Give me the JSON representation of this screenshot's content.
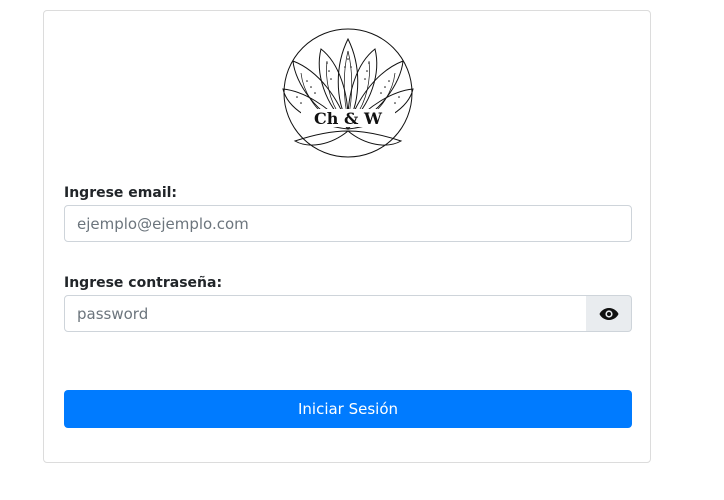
{
  "logo": {
    "text": "Ch & W"
  },
  "form": {
    "email_label": "Ingrese email:",
    "email_placeholder": "ejemplo@ejemplo.com",
    "email_value": "",
    "password_label": "Ingrese contraseña:",
    "password_placeholder": "password",
    "password_value": "",
    "toggle_icon": "eye-icon",
    "submit_label": "Iniciar Sesión"
  },
  "colors": {
    "primary": "#007bff",
    "addon_bg": "#e9ecef",
    "border": "#ced4da",
    "card_border": "#dcdcdc"
  }
}
